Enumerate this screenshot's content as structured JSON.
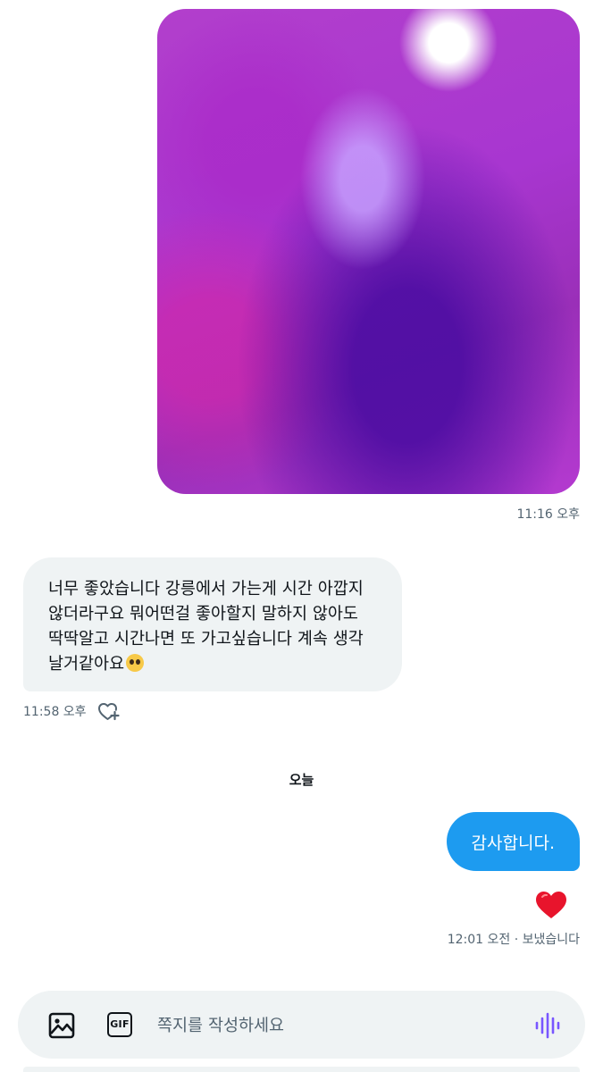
{
  "photo_message": {
    "timestamp": "11:16 오후"
  },
  "incoming_message": {
    "lines": [
      "너무 좋았습니다 강릉에서 가는게 시간 아깝지",
      "않더라구요 뭐어떤걸 좋아할지 말하지 않아도",
      "딱딱알고 시간나면 또 가고싶습니다 계속 생각",
      "날거같아요"
    ],
    "emoji": "pleading-face",
    "timestamp": "11:58 오후"
  },
  "date_separator": "오늘",
  "outgoing_message": {
    "text": "감사합니다.",
    "reaction": "red-heart",
    "timestamp": "12:01 오전 · 보냈습니다"
  },
  "composer": {
    "placeholder": "쪽지를 작성하세요",
    "gif_label": "GIF"
  },
  "colors": {
    "accent": "#1d9bf0",
    "bubble_gray": "#eff3f4",
    "meta_text": "#536471",
    "voice_icon": "#7856ff",
    "heart": "#f91880"
  }
}
